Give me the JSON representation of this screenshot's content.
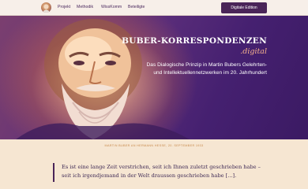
{
  "nav": {
    "links": [
      "Projekt",
      "Methodik",
      "WissKomm",
      "Beteiligte"
    ],
    "edition_button": "Digitale Edition"
  },
  "hero": {
    "title": "BUBER-KORRESPONDENZEN",
    "title_suffix": ".digital",
    "subtitle": "Das Dialogische Prinzip in Martin Bubers Gelehrten- und Intellektuellennetzwerken im 20. Jahrhundert"
  },
  "quote": {
    "caption": "MARTIN BUBER AN HERMANN HESSE, 20. SEPTEMBER 1933",
    "text": "Es ist eine lange Zeit verstrichen, seit ich Ihnen zuletzt geschrieben habe – seit ich irgendjemand in der Welt draussen geschrieben habe [...]."
  },
  "colors": {
    "accent": "#4a2558",
    "hero_gradient_warm": "#d78a55",
    "hero_gradient_cool": "#452070",
    "suffix": "#f6b28c",
    "caption": "#c88a4c",
    "background": "#f6e6d2"
  }
}
